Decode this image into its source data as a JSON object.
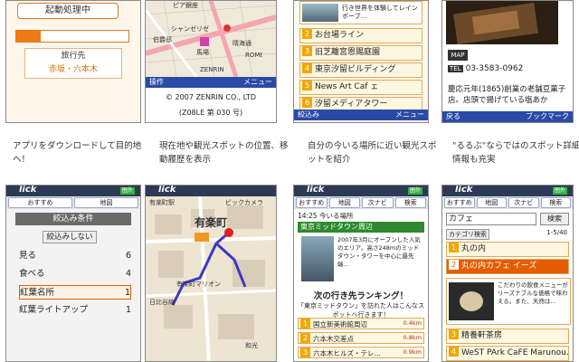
{
  "phone1": {
    "button_label": "起動処理中",
    "progress": 0.22,
    "dest_label": "旅行先",
    "dest_value": "赤坂・六本木"
  },
  "phone2": {
    "map_labels": [
      "ピア銀座",
      "シャンゼリゼ",
      "伯爵邸",
      "馬場",
      "晴海通",
      "ROMt",
      "ZENRIN"
    ],
    "softkey_left": "操作",
    "softkey_right": "メニュー",
    "copyright_line1": "© 2007 ZENRIN CO., LTD",
    "copyright_line2": "(Z08LE 第 030 号)"
  },
  "phone3": {
    "banner_text": "行き世界を体験してレインボーブ…",
    "items": [
      {
        "num": "2",
        "label": "お台場ライン"
      },
      {
        "num": "3",
        "label": "旧芝離宮恩賜庭園"
      },
      {
        "num": "4",
        "label": "東京汐留ビルディング"
      },
      {
        "num": "5",
        "label": "News Art Caf ェ"
      },
      {
        "num": "6",
        "label": "汐留メディアタワー"
      }
    ],
    "softkey_left": "絞込み",
    "softkey_right": "メニュー"
  },
  "phone4": {
    "map_label": "MAP",
    "tel_label": "TEL",
    "tel_value": "03-3583-0962",
    "desc": "慶応元年(1865)創業の老舗豆菓子店。店頭で揚げている塩あか",
    "softkey_left": "戻る",
    "softkey_right": "ブックマーク"
  },
  "captions": [
    "アプリをダウンロードして目的地へ！",
    "現在地や観光スポットの位置、移動履歴を表示",
    "自分の今いる場所に近い観光スポットを紹介",
    "\"るるぶ\"ならではのスポット詳細情報も充実"
  ],
  "app": {
    "logo": "lick",
    "battery": "圏外",
    "tools": [
      "おすすめ",
      "地図",
      "次ナビ",
      "検索"
    ]
  },
  "phone5": {
    "title": "絞込み条件",
    "reset": "絞込みしない",
    "items": [
      {
        "label": "見る",
        "count": "6"
      },
      {
        "label": "食べる",
        "count": "4"
      },
      {
        "label": "紅葉名所",
        "count": "1"
      },
      {
        "label": "紅葉ライトアップ",
        "count": "1"
      }
    ]
  },
  "phone6": {
    "station_label": "有楽町駅",
    "area_label": "有楽町",
    "map_labels": [
      "ビックカメラ",
      "有楽町マリオン",
      "日比谷線",
      "和光"
    ]
  },
  "phone7": {
    "time_label": "14:25 今いる場所",
    "place": "東京ミッドタウン周辺",
    "place_desc": "2007年3月にオープンした人気のエリア。高さ248mのミッドタウン・タワーを中心に最先端…",
    "rank_head": "次の行き先ランキング！",
    "rank_sub": "「東京ミッドタウン」を訪れた人はこんなスポットへ行きます！",
    "ranks": [
      {
        "label": "国立新美術館周辺",
        "dist": "0.4km"
      },
      {
        "label": "六本木交差点",
        "dist": "0.8km"
      },
      {
        "label": "六本木ヒルズ・テレ…",
        "dist": "0.9km"
      }
    ]
  },
  "phone8": {
    "search_value": "カフェ",
    "search_btn": "検索",
    "category": "カテゴリ検索",
    "pager": "1-5/40",
    "items": [
      {
        "num": "1",
        "label": "丸の内"
      },
      {
        "num": "2",
        "label": "丸の内カフェ イーズ"
      },
      {
        "num": "3",
        "label": "精養軒茶房"
      },
      {
        "num": "4",
        "label": "WeST PArk CaFE Marunou…"
      }
    ],
    "selected_desc": "こだわりの飲食メニューがリーズナブルな価格で味わえる。また、天然は…"
  },
  "colors": {
    "accent_orange": "#e65c00",
    "softkey_blue": "#2a4aa8",
    "tag_green": "#2e8a2e"
  }
}
